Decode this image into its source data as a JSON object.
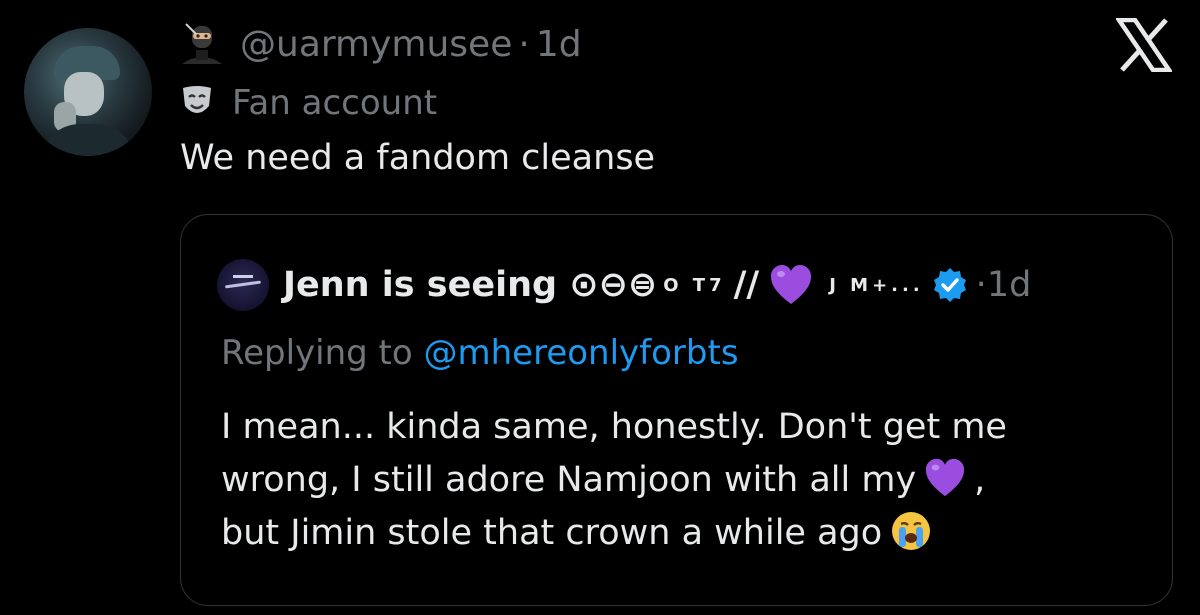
{
  "tweet": {
    "handle": "@uarmymusee",
    "time": "1d",
    "separator": "·",
    "label": "Fan account",
    "text": "We need a fandom cleanse"
  },
  "quoted": {
    "name": "Jenn is seeing ⊙⊖⊜",
    "name_superscript": "O T7",
    "name_slash": "//",
    "name_tail": "J M+...",
    "separator": "·",
    "time": "1d",
    "replying_prefix": "Replying to",
    "replying_to": "@mhereonlyforbts",
    "body_line1": "I mean... kinda same, honestly. Don't get me",
    "body_line2a": "wrong, I still adore Namjoon with all my",
    "body_line2b": ",",
    "body_line3": "but Jimin stole that crown a while ago"
  },
  "icons": {
    "header_emoji": "ninja-icon",
    "label_emoji": "performing-arts-mask-icon",
    "name_emoji": "purple-heart-icon",
    "badge": "verified-badge-icon",
    "body_emoji_1": "purple-heart-icon",
    "body_emoji_2": "loudly-crying-face-icon",
    "brand": "x-logo-icon"
  },
  "colors": {
    "background": "#000000",
    "text": "#e7e9ea",
    "secondary": "#71767b",
    "link": "#1d9bf0",
    "border": "#2f3336",
    "heart": "#9b4de0",
    "verified": "#1d9bf0"
  }
}
